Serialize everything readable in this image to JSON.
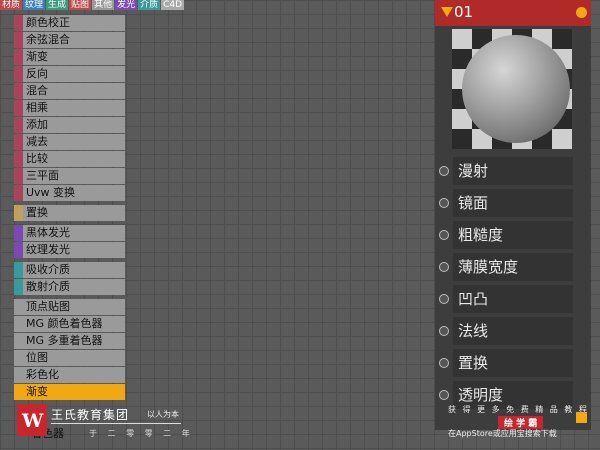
{
  "tabs": [
    {
      "label": "材质",
      "color": "#b84a4a"
    },
    {
      "label": "纹理",
      "color": "#3d7fb5"
    },
    {
      "label": "生成",
      "color": "#3a9a7d"
    },
    {
      "label": "贴图",
      "color": "#b84a4a"
    },
    {
      "label": "其他",
      "color": "#9a9a9a"
    },
    {
      "label": "发光",
      "color": "#7a4ab0"
    },
    {
      "label": "介质",
      "color": "#3a9a9a"
    },
    {
      "label": "C4D",
      "color": "#aaaaaa"
    }
  ],
  "node_groups": [
    {
      "color": "#a8455a",
      "items": [
        "颜色校正",
        "余弦混合",
        "渐变",
        "反向",
        "混合",
        "相乘",
        "添加",
        "减去",
        "比较",
        "三平面",
        "Uvw 变换"
      ]
    },
    {
      "color": "#c0a060",
      "items": [
        "置换"
      ]
    },
    {
      "color": "#7a4ab0",
      "items": [
        "黑体发光",
        "纹理发光"
      ]
    },
    {
      "color": "#3a9a9a",
      "items": [
        "吸收介质",
        "散射介质"
      ]
    },
    {
      "color": "#9a9a9a",
      "items": [
        "顶点贴图",
        "MG 颜色着色器",
        "MG 多重着色器",
        "位图",
        "彩色化"
      ]
    }
  ],
  "active_item": "渐变",
  "bottom_item": "着色器",
  "material_node": {
    "title": "01",
    "ports": [
      "漫射",
      "镜面",
      "粗糙度",
      "薄膜宽度",
      "凹凸",
      "法线",
      "置换",
      "透明度"
    ]
  },
  "watermark_left": {
    "logo_glyph": "W",
    "name": "王氏教育集团",
    "slogan": "以人为本",
    "sub": "于 二 零 零 二 年"
  },
  "watermark_right": {
    "line1": "获 得 更 多 免 费 精 品 教 程",
    "line2": "绘 学 霸",
    "line3": "在AppStore或应用宝搜索下载"
  }
}
